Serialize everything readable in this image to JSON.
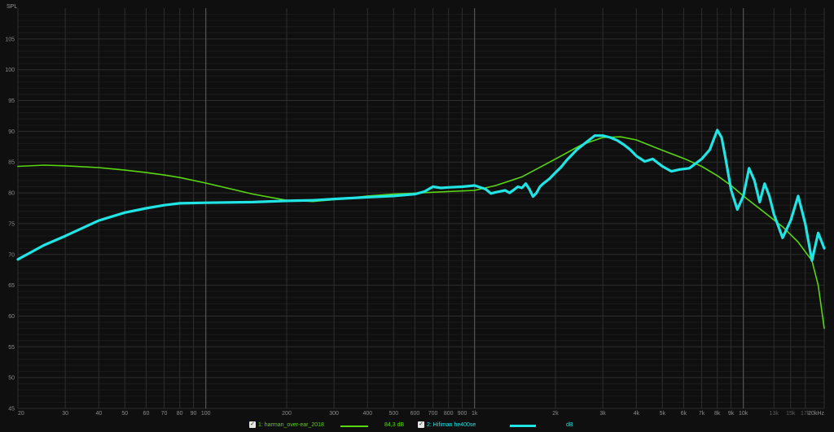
{
  "chart_data": {
    "type": "line",
    "ylabel": "SPL",
    "xscale": "log",
    "xlim": [
      20,
      20000
    ],
    "ylim": [
      45,
      110
    ],
    "y_ticks": [
      45,
      50,
      55,
      60,
      65,
      70,
      75,
      80,
      85,
      90,
      95,
      100,
      105
    ],
    "x_ticks": [
      {
        "v": 20,
        "l": "20"
      },
      {
        "v": 30,
        "l": "30"
      },
      {
        "v": 40,
        "l": "40"
      },
      {
        "v": 50,
        "l": "50"
      },
      {
        "v": 60,
        "l": "60"
      },
      {
        "v": 70,
        "l": "70"
      },
      {
        "v": 80,
        "l": "80"
      },
      {
        "v": 90,
        "l": "90"
      },
      {
        "v": 100,
        "l": "100"
      },
      {
        "v": 200,
        "l": "200"
      },
      {
        "v": 300,
        "l": "300"
      },
      {
        "v": 400,
        "l": "400"
      },
      {
        "v": 500,
        "l": "500"
      },
      {
        "v": 600,
        "l": "600"
      },
      {
        "v": 700,
        "l": "700"
      },
      {
        "v": 800,
        "l": "800"
      },
      {
        "v": 900,
        "l": "900"
      },
      {
        "v": 1000,
        "l": "1k"
      },
      {
        "v": 2000,
        "l": "2k"
      },
      {
        "v": 3000,
        "l": "3k"
      },
      {
        "v": 4000,
        "l": "4k"
      },
      {
        "v": 5000,
        "l": "5k"
      },
      {
        "v": 6000,
        "l": "6k"
      },
      {
        "v": 7000,
        "l": "7k"
      },
      {
        "v": 8000,
        "l": "8k"
      },
      {
        "v": 9000,
        "l": "9k"
      },
      {
        "v": 10000,
        "l": "10k"
      },
      {
        "v": 13000,
        "l": "13k",
        "dim": true
      },
      {
        "v": 15000,
        "l": "15k",
        "dim": true
      },
      {
        "v": 17000,
        "l": "17k",
        "dim": true
      },
      {
        "v": 20000,
        "l": "20kHz"
      }
    ],
    "grid": true,
    "series": [
      {
        "name": "1: harman_over-ear_2018",
        "level": "84,3 dB",
        "color": "#58d60f",
        "x": [
          20,
          25,
          30,
          40,
          50,
          60,
          70,
          80,
          100,
          150,
          200,
          250,
          300,
          400,
          500,
          700,
          1000,
          1200,
          1500,
          2000,
          2500,
          3000,
          3500,
          4000,
          5000,
          6000,
          7000,
          8000,
          9000,
          10000,
          12000,
          14000,
          16000,
          18000,
          19000,
          20000
        ],
        "y": [
          84.3,
          84.5,
          84.4,
          84.1,
          83.7,
          83.3,
          82.9,
          82.5,
          81.6,
          79.8,
          78.8,
          78.6,
          78.9,
          79.5,
          79.8,
          80.1,
          80.4,
          81.2,
          82.6,
          85.5,
          87.8,
          89.0,
          89.1,
          88.6,
          86.9,
          85.6,
          84.3,
          82.8,
          81.2,
          79.5,
          76.8,
          74.5,
          72.0,
          69.0,
          65.0,
          58.0
        ]
      },
      {
        "name": "2: Hifiman he400se",
        "level": "dB",
        "color": "#21e4e4",
        "x": [
          20,
          25,
          30,
          40,
          50,
          60,
          70,
          80,
          100,
          150,
          200,
          250,
          300,
          400,
          500,
          600,
          650,
          700,
          750,
          800,
          900,
          1000,
          1100,
          1150,
          1200,
          1300,
          1350,
          1400,
          1450,
          1500,
          1550,
          1600,
          1650,
          1700,
          1750,
          1800,
          1900,
          2000,
          2100,
          2200,
          2400,
          2600,
          2800,
          3000,
          3200,
          3400,
          3600,
          3800,
          4000,
          4300,
          4600,
          5000,
          5400,
          5800,
          6300,
          7000,
          7500,
          8000,
          8300,
          8600,
          9000,
          9500,
          10000,
          10500,
          11000,
          11500,
          12000,
          12500,
          13000,
          14000,
          15000,
          16000,
          17000,
          18000,
          19000,
          20000
        ],
        "y": [
          69.2,
          71.5,
          73.0,
          75.5,
          76.8,
          77.5,
          78.0,
          78.3,
          78.4,
          78.5,
          78.7,
          78.8,
          79.0,
          79.3,
          79.5,
          79.8,
          80.2,
          81.0,
          80.8,
          80.9,
          81.0,
          81.2,
          80.6,
          79.9,
          80.1,
          80.4,
          80.0,
          80.5,
          81.0,
          80.8,
          81.5,
          80.6,
          79.4,
          80.0,
          81.0,
          81.5,
          82.3,
          83.3,
          84.2,
          85.3,
          87.0,
          88.2,
          89.3,
          89.3,
          89.0,
          88.5,
          87.8,
          87.0,
          86.0,
          85.1,
          85.5,
          84.3,
          83.5,
          83.8,
          84.0,
          85.5,
          87.0,
          90.2,
          89.0,
          85.5,
          80.5,
          77.3,
          79.5,
          84.0,
          82.0,
          78.5,
          81.5,
          79.5,
          76.5,
          72.7,
          75.5,
          79.5,
          75.0,
          69.0,
          73.5,
          71.0
        ]
      }
    ]
  }
}
